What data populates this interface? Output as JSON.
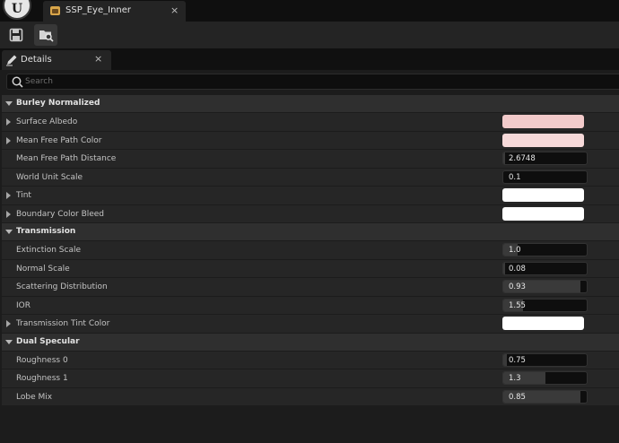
{
  "titlebar": {
    "asset_tab_label": "SSP_Eye_Inner",
    "close_glyph": "×"
  },
  "panel_tab": {
    "label": "Details",
    "close_glyph": "×"
  },
  "search": {
    "placeholder": "Search",
    "value": ""
  },
  "icons": {
    "save": "save-icon",
    "browse": "browse-asset-icon",
    "details": "pencil-icon",
    "search": "search-icon"
  },
  "sections": [
    {
      "label": "Burley Normalized",
      "rows": [
        {
          "label": "Surface Albedo",
          "expandable": true,
          "kind": "color",
          "color": "#f2caca"
        },
        {
          "label": "Mean Free Path Color",
          "expandable": true,
          "kind": "color",
          "color": "#f6d9d9"
        },
        {
          "label": "Mean Free Path Distance",
          "expandable": false,
          "kind": "number",
          "value": "2.6748",
          "fill": 0.02
        },
        {
          "label": "World Unit Scale",
          "expandable": false,
          "kind": "number",
          "value": "0.1",
          "fill": 0
        },
        {
          "label": "Tint",
          "expandable": true,
          "kind": "color",
          "color": "#ffffff"
        },
        {
          "label": "Boundary Color Bleed",
          "expandable": true,
          "kind": "color",
          "color": "#ffffff"
        }
      ]
    },
    {
      "label": "Transmission",
      "rows": [
        {
          "label": "Extinction Scale",
          "expandable": false,
          "kind": "number",
          "value": "1.0",
          "fill": 0.17
        },
        {
          "label": "Normal Scale",
          "expandable": false,
          "kind": "number",
          "value": "0.08",
          "fill": 0.02
        },
        {
          "label": "Scattering Distribution",
          "expandable": false,
          "kind": "number",
          "value": "0.93",
          "fill": 0.93
        },
        {
          "label": "IOR",
          "expandable": false,
          "kind": "number",
          "value": "1.55",
          "fill": 0.24
        },
        {
          "label": "Transmission Tint Color",
          "expandable": true,
          "kind": "color",
          "color": "#ffffff"
        }
      ]
    },
    {
      "label": "Dual Specular",
      "rows": [
        {
          "label": "Roughness 0",
          "expandable": false,
          "kind": "number",
          "value": "0.75",
          "fill": 0.04
        },
        {
          "label": "Roughness 1",
          "expandable": false,
          "kind": "number",
          "value": "1.3",
          "fill": 0.5
        },
        {
          "label": "Lobe Mix",
          "expandable": false,
          "kind": "number",
          "value": "0.85",
          "fill": 0.92
        }
      ]
    }
  ]
}
